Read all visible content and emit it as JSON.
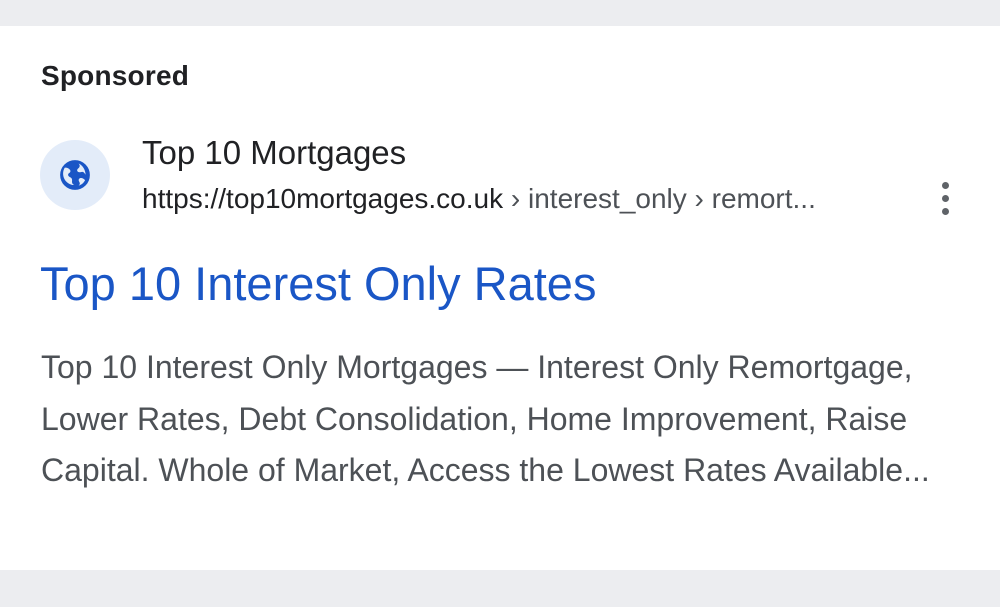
{
  "ad": {
    "sponsored_label": "Sponsored",
    "site_name": "Top 10 Mortgages",
    "url_domain": "https://top10mortgages.co.uk",
    "url_path": " › interest_only › remort...",
    "headline": "Top 10 Interest Only Rates",
    "description": "Top 10 Interest Only Mortgages — Interest Only Remortgage, Lower Rates, Debt Consolidation, Home Improvement, Raise Capital. Whole of Market, Access the Lowest Rates Available...",
    "favicon_icon": "globe-icon",
    "more_icon": "more-vert-icon"
  },
  "colors": {
    "page_background": "#ecedf0",
    "card_background": "#ffffff",
    "headline_link": "#1a56c6",
    "favicon_bg": "#e3ecf9",
    "favicon_fg": "#1a56c6",
    "body_text": "#4d5156",
    "title_text": "#202124"
  }
}
